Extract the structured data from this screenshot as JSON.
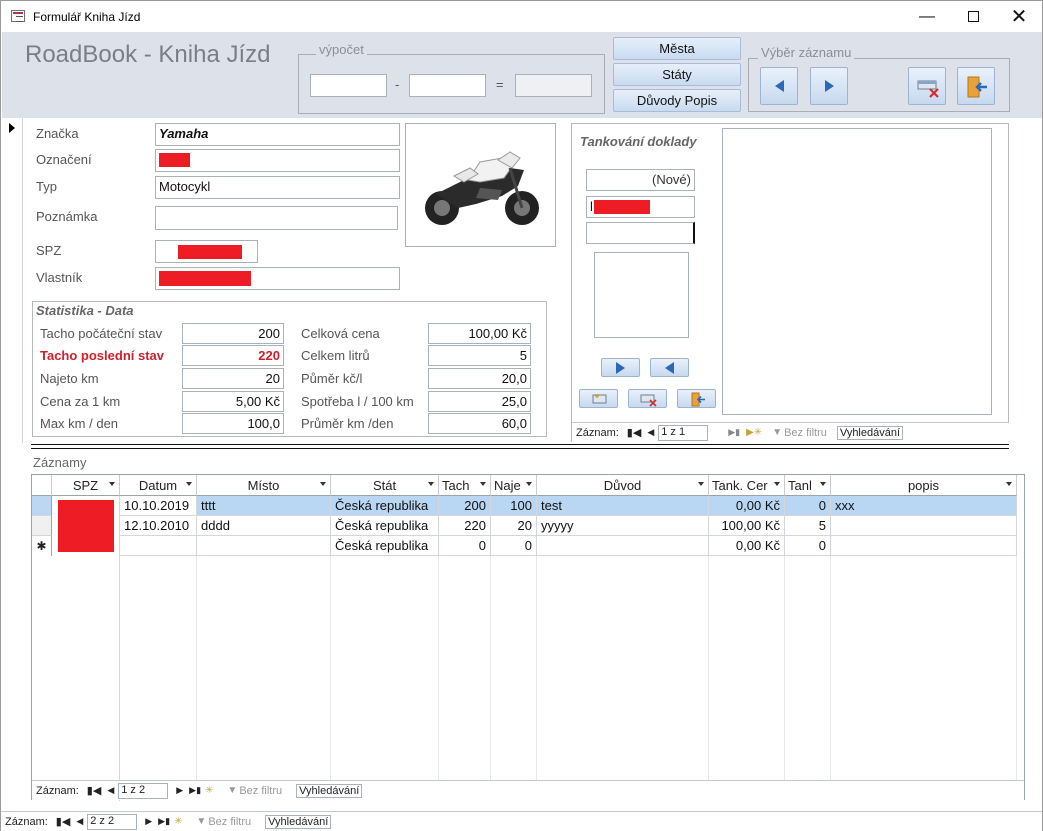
{
  "window": {
    "title": "Formulář Kniha Jízd"
  },
  "header": {
    "app_title": "RoadBook - Kniha Jízd",
    "calc_label": "výpočet",
    "calc_minus": "-",
    "calc_equals": "=",
    "buttons": {
      "mesta": "Města",
      "staty": "Státy",
      "duvody": "Důvody Popis"
    },
    "record_select_label": "Výběr záznamu"
  },
  "vehicle": {
    "labels": {
      "znacka": "Značka",
      "oznaceni": "Označení",
      "typ": "Typ",
      "poznamka": "Poznámka",
      "spz": "SPZ",
      "vlastnik": "Vlastník"
    },
    "values": {
      "znacka": "Yamaha",
      "oznaceni": "",
      "typ": "Motocykl",
      "poznamka": "",
      "spz": "",
      "vlastnik": ""
    }
  },
  "stats": {
    "title": "Statistika - Data",
    "left": [
      {
        "label": "Tacho počáteční stav",
        "value": "200"
      },
      {
        "label": "Tacho poslední stav",
        "value": "220"
      },
      {
        "label": "Najeto km",
        "value": "20"
      },
      {
        "label": "Cena za 1 km",
        "value": "5,00 Kč"
      },
      {
        "label": "Max km / den",
        "value": "100,0"
      }
    ],
    "right": [
      {
        "label": "Celková cena",
        "value": "100,00 Kč"
      },
      {
        "label": "Celkem litrů",
        "value": "5"
      },
      {
        "label": "Půměr kč/l",
        "value": "20,0"
      },
      {
        "label": "Spotřeba l / 100 km",
        "value": "25,0"
      },
      {
        "label": "Průměr km /den",
        "value": "60,0"
      }
    ],
    "highlight_color": "#d0202a"
  },
  "fuel": {
    "title": "Tankování doklady",
    "new_value": "(Nové)",
    "field2": "l",
    "field3": "",
    "nav": {
      "label": "Záznam:",
      "position": "1 z 1",
      "filter": "Bez filtru",
      "search": "Vyhledávání"
    }
  },
  "records": {
    "title": "Záznamy",
    "columns": [
      "SPZ",
      "Datum",
      "Místo",
      "Stát",
      "Tach",
      "Naje",
      "Důvod",
      "Tank. Cer",
      "Tanl",
      "popis"
    ],
    "rows": [
      {
        "datum": "10.10.2019",
        "misto": "tttt",
        "stat": "Česká republika",
        "tach": "200",
        "naje": "100",
        "duvod": "test",
        "tank": "0,00 Kč",
        "tanl": "0",
        "popis": "xxx"
      },
      {
        "datum": "12.10.2010",
        "misto": "dddd",
        "stat": "Česká republika",
        "tach": "220",
        "naje": "20",
        "duvod": "yyyyy",
        "tank": "100,00 Kč",
        "tanl": "5",
        "popis": ""
      },
      {
        "datum": "",
        "misto": "",
        "stat": "Česká republika",
        "tach": "0",
        "naje": "0",
        "duvod": "",
        "tank": "0,00 Kč",
        "tanl": "0",
        "popis": ""
      }
    ],
    "new_row_marker": "✱",
    "nav": {
      "label": "Záznam:",
      "position": "1 z 2",
      "filter": "Bez filtru",
      "search": "Vyhledávání"
    }
  },
  "form_nav": {
    "label": "Záznam:",
    "position": "2 z 2",
    "filter": "Bez filtru",
    "search": "Vyhledávání"
  },
  "colors": {
    "header_bg": "#dde2ea",
    "selected_row": "#b9d6f2",
    "redaction": "#ee1d25",
    "nav_arrow": "#2b68b8"
  }
}
